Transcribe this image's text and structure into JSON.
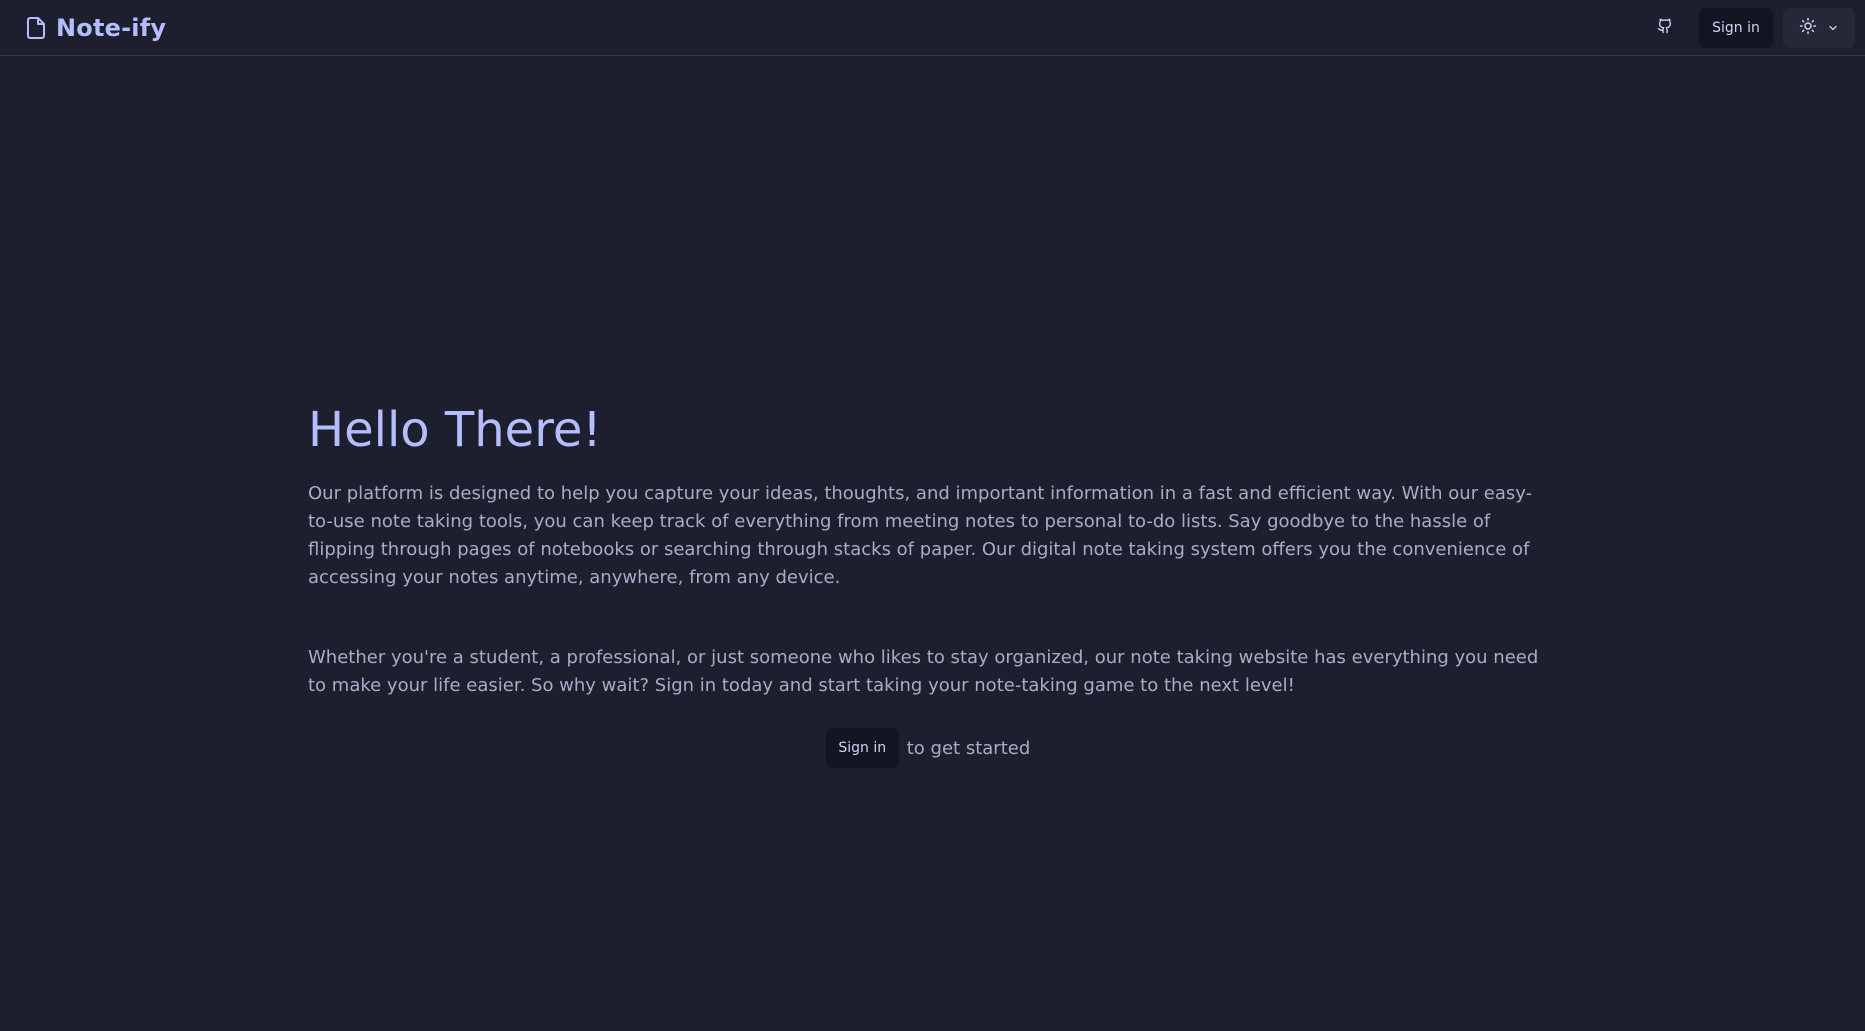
{
  "app": {
    "title": "Note-ify"
  },
  "nav": {
    "signin_label": "Sign in",
    "github_icon": "github-icon",
    "theme_icon": "sun-icon",
    "theme_chevron_icon": "chevron-down-icon"
  },
  "hero": {
    "title": "Hello There!",
    "paragraph1": "Our platform is designed to help you capture your ideas, thoughts, and important information in a fast and efficient way. With our easy-to-use note taking tools, you can keep track of everything from meeting notes to personal to-do lists. Say goodbye to the hassle of flipping through pages of notebooks or searching through stacks of paper. Our digital note taking system offers you the convenience of accessing your notes anytime, anywhere, from any device.",
    "paragraph2": "Whether you're a student, a professional, or just someone who likes to stay organized, our note taking website has everything you need to make your life easier. So why wait? Sign in today and start taking your note-taking game to the next level!",
    "cta_signin_label": "Sign in",
    "cta_text": "to get started"
  },
  "colors": {
    "background": "#1e1f2e",
    "accent": "#b4befe",
    "text": "#a6adc8",
    "button_bg": "#121422"
  }
}
